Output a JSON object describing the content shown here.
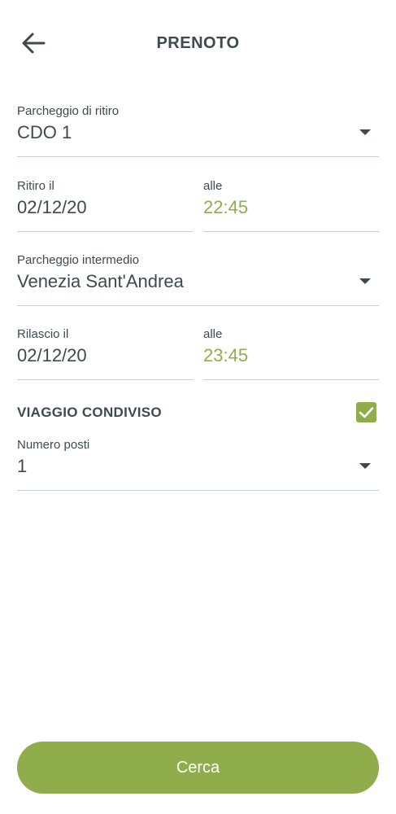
{
  "header": {
    "title": "PRENOTO",
    "back_icon": "arrow-left-icon"
  },
  "pickup_parking": {
    "label": "Parcheggio di ritiro",
    "value": "CDO 1"
  },
  "pickup_date": {
    "label": "Ritiro il",
    "value": "02/12/20"
  },
  "pickup_time": {
    "label": "alle",
    "value": "22:45"
  },
  "intermediate_parking": {
    "label": "Parcheggio intermedio",
    "value": "Venezia Sant'Andrea"
  },
  "release_date": {
    "label": "Rilascio il",
    "value": "02/12/20"
  },
  "release_time": {
    "label": "alle",
    "value": "23:45"
  },
  "shared_trip": {
    "label": "VIAGGIO CONDIVISO",
    "checked": true
  },
  "seats": {
    "label": "Numero posti",
    "value": "1"
  },
  "search_button": {
    "label": "Cerca"
  },
  "colors": {
    "accent": "#8fad4a",
    "text": "#3d4a4e",
    "divider": "#c9cfd1"
  }
}
